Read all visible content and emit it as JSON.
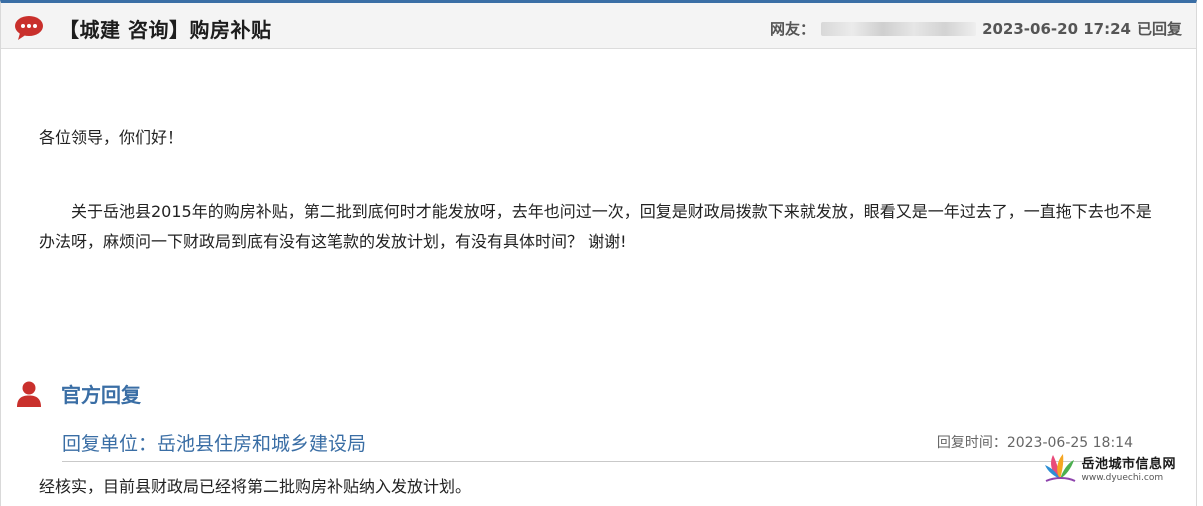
{
  "topic": {
    "title": "【城建 咨询】购房补贴",
    "author_label": "网友：",
    "date": "2023-06-20 17:24",
    "status": "已回复"
  },
  "question": {
    "greeting": "各位领导，你们好！",
    "body": "关于岳池县2015年的购房补贴，第二批到底何时才能发放呀，去年也问过一次，回复是财政局拨款下来就发放，眼看又是一年过去了，一直拖下去也不是办法呀，麻烦问一下财政局到底有没有这笔款的发放计划，有没有具体时间？ 谢谢!"
  },
  "official_reply": {
    "heading": "官方回复",
    "unit": "回复单位：岳池县住房和城乡建设局",
    "time": "回复时间：2023-06-25 18:14",
    "text": "经核实，目前县财政局已经将第二批购房补贴纳入发放计划。"
  },
  "watermark": {
    "name": "岳池城市信息网",
    "url": "www.dyuechi.com"
  },
  "colors": {
    "accent": "#3a6ea5",
    "icon_red": "#c9302c"
  },
  "icons": {
    "header": "speech-bubble-icon",
    "official": "person-icon"
  }
}
